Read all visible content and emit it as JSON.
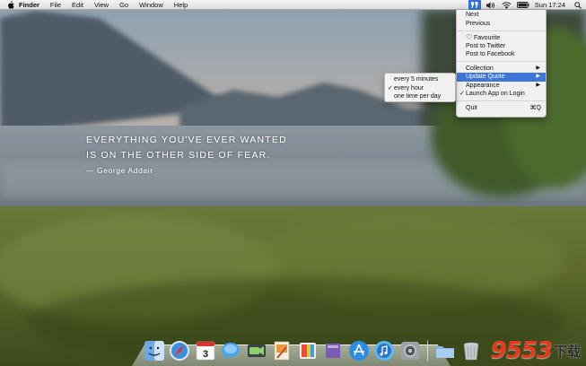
{
  "menubar": {
    "apple_icon": "apple-icon",
    "menus": [
      "Finder",
      "File",
      "Edit",
      "View",
      "Go",
      "Window",
      "Help"
    ],
    "status_icons": [
      "quote-app-icon",
      "volume-icon",
      "wifi-icon",
      "battery-icon"
    ],
    "clock": "Sun 17:24",
    "search_icon": "spotlight-search-icon"
  },
  "quote": {
    "lines": [
      "EVERYTHING YOU'VE EVER WANTED",
      "IS ON THE OTHER SIDE OF FEAR."
    ],
    "author": "— George Addair"
  },
  "dropdown": {
    "next": "Next",
    "previous": "Previous",
    "favourite": "Favourite",
    "post_twitter": "Post to Twitter",
    "post_facebook": "Post to Facebook",
    "collection": "Collection",
    "update_quote": "Update Quote",
    "appearance": "Appearance",
    "launch_login": "Launch App on Login",
    "quit": "Quit",
    "quit_shortcut": "⌘Q",
    "heart_glyph": "♡",
    "check_glyph": "✓",
    "arrow_glyph": "▶"
  },
  "submenu": {
    "items": [
      "every 5 minutes",
      "every hour",
      "one time per day"
    ],
    "checked_index": 1
  },
  "dock": {
    "apps": [
      "finder-icon",
      "safari-icon",
      "calendar-icon",
      "messages-icon",
      "facetime-icon",
      "preview-icon",
      "photos-icon",
      "ibooks-icon",
      "app-store-icon",
      "itunes-icon",
      "system-preferences-icon"
    ],
    "calendar_day": "3",
    "stacks": [
      "downloads-folder-icon",
      "trash-icon"
    ]
  },
  "watermark": {
    "number": "9553",
    "chinese": "下载"
  },
  "colors": {
    "menu_highlight": "#3e75d8",
    "watermark_red": "#e63a1e"
  }
}
